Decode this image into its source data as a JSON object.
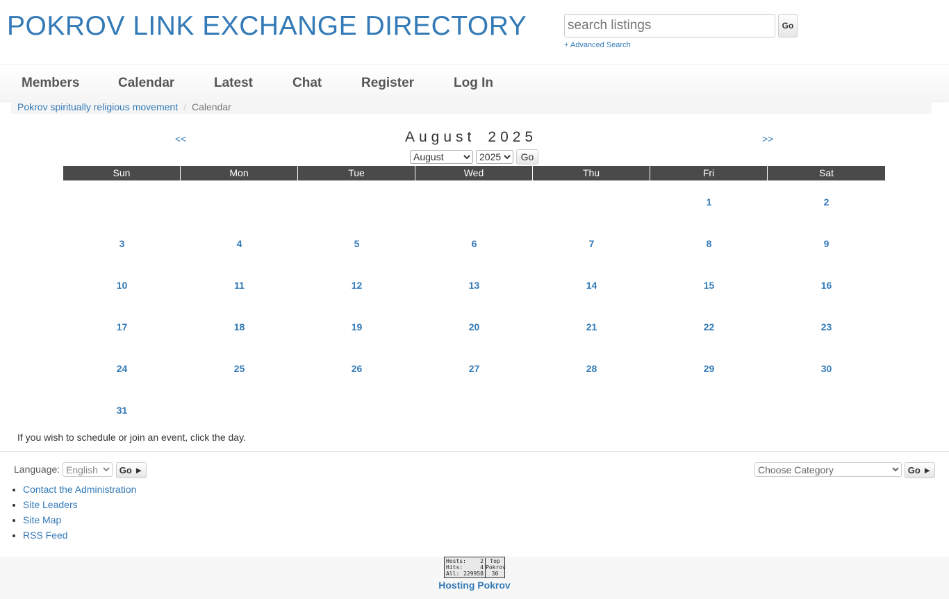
{
  "header": {
    "site_title": "POKROV LINK EXCHANGE DIRECTORY",
    "search_placeholder": "search listings",
    "search_go": "Go",
    "advanced_search": "+ Advanced Search"
  },
  "nav": {
    "items": [
      {
        "label": "Members"
      },
      {
        "label": "Calendar"
      },
      {
        "label": "Latest"
      },
      {
        "label": "Chat"
      },
      {
        "label": "Register"
      },
      {
        "label": "Log In"
      }
    ]
  },
  "breadcrumb": {
    "home": "Pokrov spiritually religious movement",
    "separator": "/",
    "current": "Calendar"
  },
  "calendar": {
    "prev": "<<",
    "next": ">>",
    "month_name": "August",
    "year": "2025",
    "month_select_value": "August",
    "year_select_value": "2025",
    "go_label": "Go",
    "day_names": [
      "Sun",
      "Mon",
      "Tue",
      "Wed",
      "Thu",
      "Fri",
      "Sat"
    ],
    "weeks": [
      [
        "",
        "",
        "",
        "",
        "",
        "1",
        "2"
      ],
      [
        "3",
        "4",
        "5",
        "6",
        "7",
        "8",
        "9"
      ],
      [
        "10",
        "11",
        "12",
        "13",
        "14",
        "15",
        "16"
      ],
      [
        "17",
        "18",
        "19",
        "20",
        "21",
        "22",
        "23"
      ],
      [
        "24",
        "25",
        "26",
        "27",
        "28",
        "29",
        "30"
      ],
      [
        "31",
        "",
        "",
        "",
        "",
        "",
        ""
      ]
    ],
    "info": "If you wish to schedule or join an event, click the day."
  },
  "footer": {
    "language_label": "Language:",
    "language_value": "English",
    "language_go": "Go ►",
    "category_placeholder": "Choose Category",
    "category_go": "Go ►",
    "links": [
      "Contact the Administration",
      "Site Leaders",
      "Site Map",
      "RSS Feed"
    ],
    "counter": {
      "hosts_label": "Hosts:",
      "hosts": "2",
      "hits_label": "Hits:",
      "hits": "4",
      "all_label": "All:",
      "all": "229958",
      "top_label": "Top",
      "brand": "Pokrov",
      "rank": "30"
    },
    "hosting": "Hosting Pokrov"
  }
}
